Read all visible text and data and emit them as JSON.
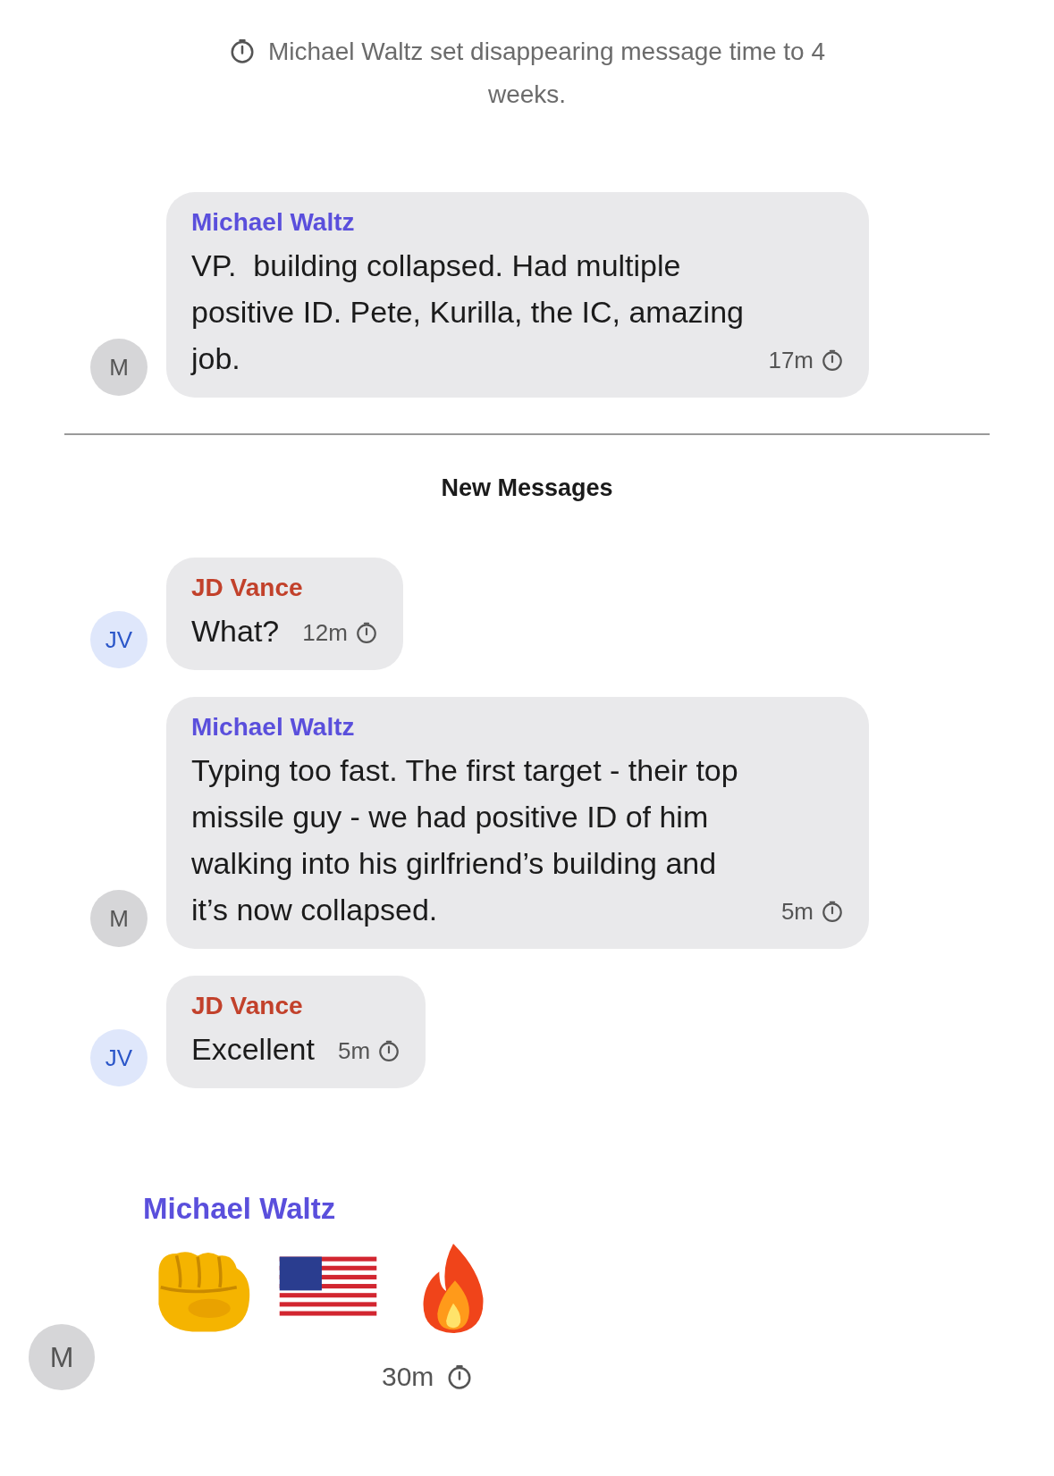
{
  "items": [
    {
      "kind": "system",
      "text": "Michael Waltz set disappearing message time to 4 weeks."
    },
    {
      "kind": "bubble",
      "sender": "Michael Waltz",
      "color": "#5a4fdc",
      "avatar": {
        "initials": "M",
        "color": "#d6d6d8"
      },
      "text": "VP.  building collapsed. Had multiple positive ID. Pete, Kurilla, the IC, amazing job.",
      "time": "17m"
    },
    {
      "kind": "divider",
      "label": "New Messages"
    },
    {
      "kind": "bubble",
      "sender": "JD Vance",
      "color": "#c2412b",
      "avatar": {
        "initials": "JV",
        "color": "#dfe7fb"
      },
      "text": "What?",
      "time": "12m"
    },
    {
      "kind": "bubble",
      "sender": "Michael Waltz",
      "color": "#5a4fdc",
      "avatar": {
        "initials": "M",
        "color": "#d6d6d8"
      },
      "text": "Typing too fast. The first target - their top missile guy - we had positive ID of him walking into his girlfriend’s building and it’s now collapsed.",
      "time": "5m"
    },
    {
      "kind": "bubble",
      "sender": "JD Vance",
      "color": "#c2412b",
      "avatar": {
        "initials": "JV",
        "color": "#dfe7fb"
      },
      "text": "Excellent",
      "time": "5m"
    },
    {
      "kind": "emoji",
      "sender": "Michael Waltz",
      "color": "#5a4fdc",
      "avatar": {
        "initials": "M",
        "color": "#d6d6d8"
      },
      "emojis": [
        {
          "kind": "fist"
        },
        {
          "kind": "flag"
        },
        {
          "kind": "fire"
        }
      ],
      "time": "30m"
    }
  ]
}
